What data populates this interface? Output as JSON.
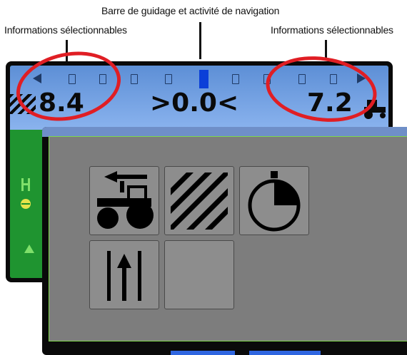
{
  "annotations": {
    "top_label": "Barre de guidage et activité de navigation",
    "left_label": "Informations sélectionnables",
    "right_label": "Informations sélectionnables"
  },
  "back_screen": {
    "readout_left": "8.4",
    "readout_center": ">0.0<",
    "readout_right": "7.2"
  },
  "colors": {
    "highlight": "#e01e24",
    "guidance_active": "#0b3fd8",
    "field_green": "#1f9430",
    "panel_gray": "#7d7d7d",
    "panel_border": "#7fd84a"
  },
  "menu": {
    "tiles": [
      {
        "icon": "tractor-arrow-left-icon"
      },
      {
        "icon": "hatch-pattern-icon"
      },
      {
        "icon": "stopwatch-icon"
      },
      {
        "icon": "guidance-lines-arrow-icon"
      },
      {
        "icon": "empty-tile"
      }
    ]
  }
}
